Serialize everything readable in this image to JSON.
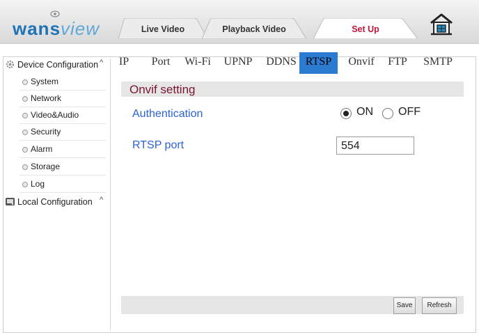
{
  "brand": {
    "logo_part1": "wans",
    "logo_part2": "view"
  },
  "top_tabs": [
    {
      "label": "Live Video"
    },
    {
      "label": "Playback Video"
    },
    {
      "label": "Set Up"
    }
  ],
  "active_top_tab": "Set Up",
  "sidebar": {
    "device_group": "Device Configuration",
    "device_items": [
      {
        "label": "System"
      },
      {
        "label": "Network"
      },
      {
        "label": "Video&Audio"
      },
      {
        "label": "Security"
      },
      {
        "label": "Alarm"
      },
      {
        "label": "Storage"
      },
      {
        "label": "Log"
      }
    ],
    "local_group": "Local Configuration",
    "caret": "^"
  },
  "sub_tabs": [
    {
      "label": "IP"
    },
    {
      "label": "Port"
    },
    {
      "label": "Wi-Fi"
    },
    {
      "label": "UPNP"
    },
    {
      "label": "DDNS"
    },
    {
      "label": "RTSP"
    },
    {
      "label": "Onvif"
    },
    {
      "label": "FTP"
    },
    {
      "label": "SMTP"
    }
  ],
  "active_sub_tab": "RTSP",
  "section": {
    "title": "Onvif setting"
  },
  "fields": {
    "authentication": {
      "label": "Authentication",
      "on": "ON",
      "off": "OFF",
      "selected": "ON"
    },
    "rtsp_port": {
      "label": "RTSP port",
      "value": "554"
    }
  },
  "buttons": {
    "save": "Save",
    "refresh": "Refresh"
  },
  "colors": {
    "accent": "#2b7bd2",
    "section_title": "#7a1530",
    "field_label": "#2a62d6",
    "active_tab_text": "#c0143c"
  }
}
